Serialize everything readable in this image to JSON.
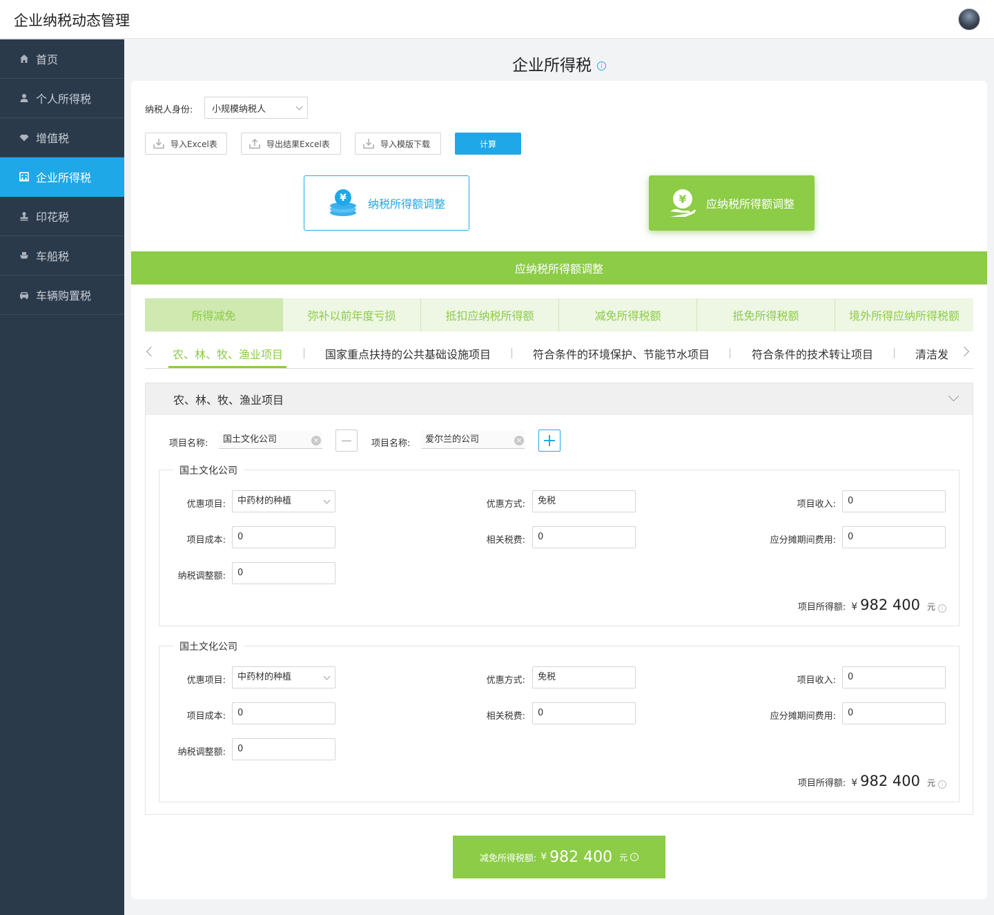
{
  "app": {
    "title": "企业纳税动态管理"
  },
  "sidebar": {
    "items": [
      {
        "label": "首页",
        "icon": "home-icon",
        "active": false
      },
      {
        "label": "个人所得税",
        "icon": "user-icon",
        "active": false
      },
      {
        "label": "增值税",
        "icon": "diamond-icon",
        "active": false
      },
      {
        "label": "企业所得税",
        "icon": "building-icon",
        "active": true
      },
      {
        "label": "印花税",
        "icon": "stamp-icon",
        "active": false
      },
      {
        "label": "车船税",
        "icon": "ship-icon",
        "active": false
      },
      {
        "label": "车辆购置税",
        "icon": "car-icon",
        "active": false
      }
    ]
  },
  "page": {
    "title": "企业所得税",
    "info_icon": "i"
  },
  "identity": {
    "label": "纳税人身份:",
    "value": "小规模纳税人"
  },
  "toolbar": {
    "import_excel": "导入Excel表",
    "export_excel": "导出结果Excel表",
    "download_template": "导入模版下载",
    "calculate": "计算"
  },
  "mode_buttons": {
    "taxable_income_adjust": "纳税所得额调整",
    "payable_income_adjust": "应纳税所得额调整"
  },
  "section_bar": {
    "title": "应纳税所得额调整"
  },
  "tabs": [
    {
      "label": "所得减免",
      "active": true
    },
    {
      "label": "弥补以前年度亏损",
      "active": false
    },
    {
      "label": "抵扣应纳税所得额",
      "active": false
    },
    {
      "label": "减免所得税额",
      "active": false
    },
    {
      "label": "抵免所得税额",
      "active": false
    },
    {
      "label": "境外所得应纳所得税额",
      "active": false
    }
  ],
  "subtabs": [
    {
      "label": "农、林、牧、渔业项目",
      "active": true
    },
    {
      "label": "国家重点扶持的公共基础设施项目",
      "active": false
    },
    {
      "label": "符合条件的环境保护、节能节水项目",
      "active": false
    },
    {
      "label": "符合条件的技术转让项目",
      "active": false
    },
    {
      "label": "清洁发",
      "active": false
    }
  ],
  "panel": {
    "title": "农、林、牧、渔业项目",
    "project_label": "项目名称:",
    "projects": [
      "国土文化公司",
      "爱尔兰的公司"
    ],
    "groups": [
      {
        "title": "国土文化公司",
        "preferential_item_label": "优惠项目:",
        "preferential_item": "中药材的种植",
        "preferential_method_label": "优惠方式:",
        "preferential_method": "免税",
        "income_label": "项目收入:",
        "income": "0",
        "cost_label": "项目成本:",
        "cost": "0",
        "taxes_label": "相关税费:",
        "taxes": "0",
        "period_expense_label": "应分摊期间费用:",
        "period_expense": "0",
        "adjustment_label": "纳税调整额:",
        "adjustment": "0",
        "result_label": "项目所得额:",
        "currency": "¥",
        "result": "982 400",
        "unit": "元"
      },
      {
        "title": "国土文化公司",
        "preferential_item_label": "优惠项目:",
        "preferential_item": "中药材的种植",
        "preferential_method_label": "优惠方式:",
        "preferential_method": "免税",
        "income_label": "项目收入:",
        "income": "0",
        "cost_label": "项目成本:",
        "cost": "0",
        "taxes_label": "相关税费:",
        "taxes": "0",
        "period_expense_label": "应分摊期间费用:",
        "period_expense": "0",
        "adjustment_label": "纳税调整额:",
        "adjustment": "0",
        "result_label": "项目所得额:",
        "currency": "¥",
        "result": "982 400",
        "unit": "元"
      }
    ]
  },
  "total": {
    "label": "减免所得税额:",
    "currency": "¥",
    "amount": "982 400",
    "unit": "元"
  },
  "colors": {
    "primary_blue": "#1fa8e8",
    "green": "#8ccc46",
    "sidebar_bg": "#2a3a4b"
  }
}
